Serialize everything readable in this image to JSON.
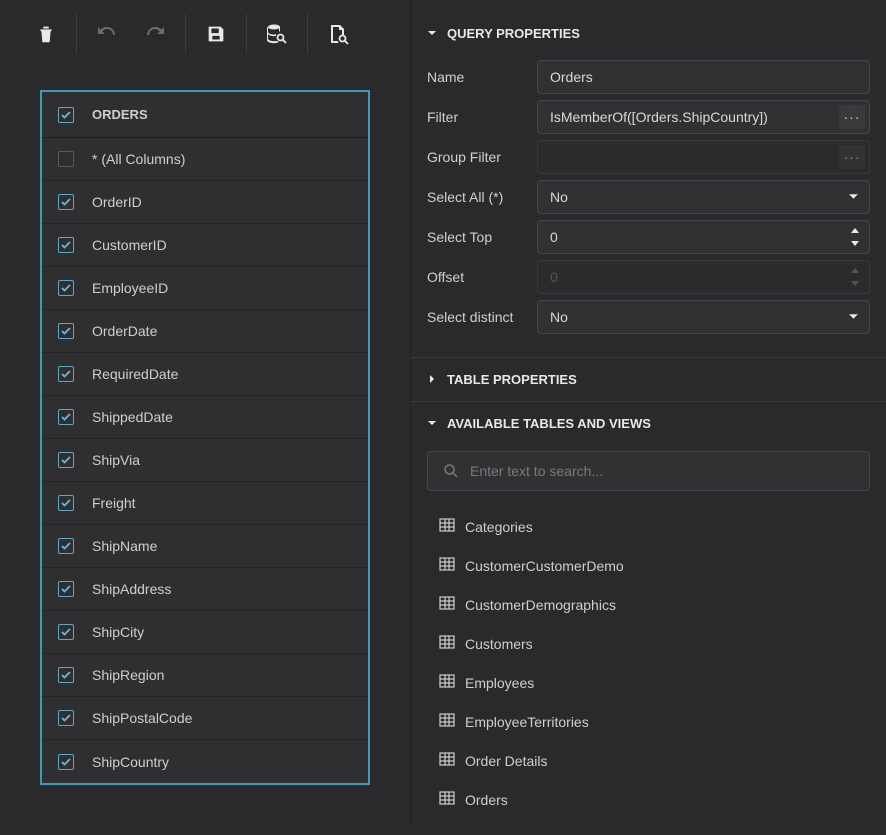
{
  "table": {
    "name": "ORDERS",
    "allColumnsLabel": "* (All Columns)",
    "columns": [
      {
        "name": "OrderID",
        "checked": true
      },
      {
        "name": "CustomerID",
        "checked": true
      },
      {
        "name": "EmployeeID",
        "checked": true
      },
      {
        "name": "OrderDate",
        "checked": true
      },
      {
        "name": "RequiredDate",
        "checked": true
      },
      {
        "name": "ShippedDate",
        "checked": true
      },
      {
        "name": "ShipVia",
        "checked": true
      },
      {
        "name": "Freight",
        "checked": true
      },
      {
        "name": "ShipName",
        "checked": true
      },
      {
        "name": "ShipAddress",
        "checked": true
      },
      {
        "name": "ShipCity",
        "checked": true
      },
      {
        "name": "ShipRegion",
        "checked": true
      },
      {
        "name": "ShipPostalCode",
        "checked": true
      },
      {
        "name": "ShipCountry",
        "checked": true
      }
    ]
  },
  "sections": {
    "queryProperties": "QUERY PROPERTIES",
    "tableProperties": "TABLE PROPERTIES",
    "availableTables": "AVAILABLE TABLES AND VIEWS"
  },
  "props": {
    "name": {
      "label": "Name",
      "value": "Orders"
    },
    "filter": {
      "label": "Filter",
      "value": "IsMemberOf([Orders.ShipCountry])"
    },
    "groupFilter": {
      "label": "Group Filter",
      "value": ""
    },
    "selectAll": {
      "label": "Select All (*)",
      "value": "No"
    },
    "selectTop": {
      "label": "Select Top",
      "value": "0"
    },
    "offset": {
      "label": "Offset",
      "value": "0"
    },
    "selectDistinct": {
      "label": "Select distinct",
      "value": "No"
    }
  },
  "search": {
    "placeholder": "Enter text to search..."
  },
  "availableTables": [
    "Categories",
    "CustomerCustomerDemo",
    "CustomerDemographics",
    "Customers",
    "Employees",
    "EmployeeTerritories",
    "Order Details",
    "Orders"
  ]
}
